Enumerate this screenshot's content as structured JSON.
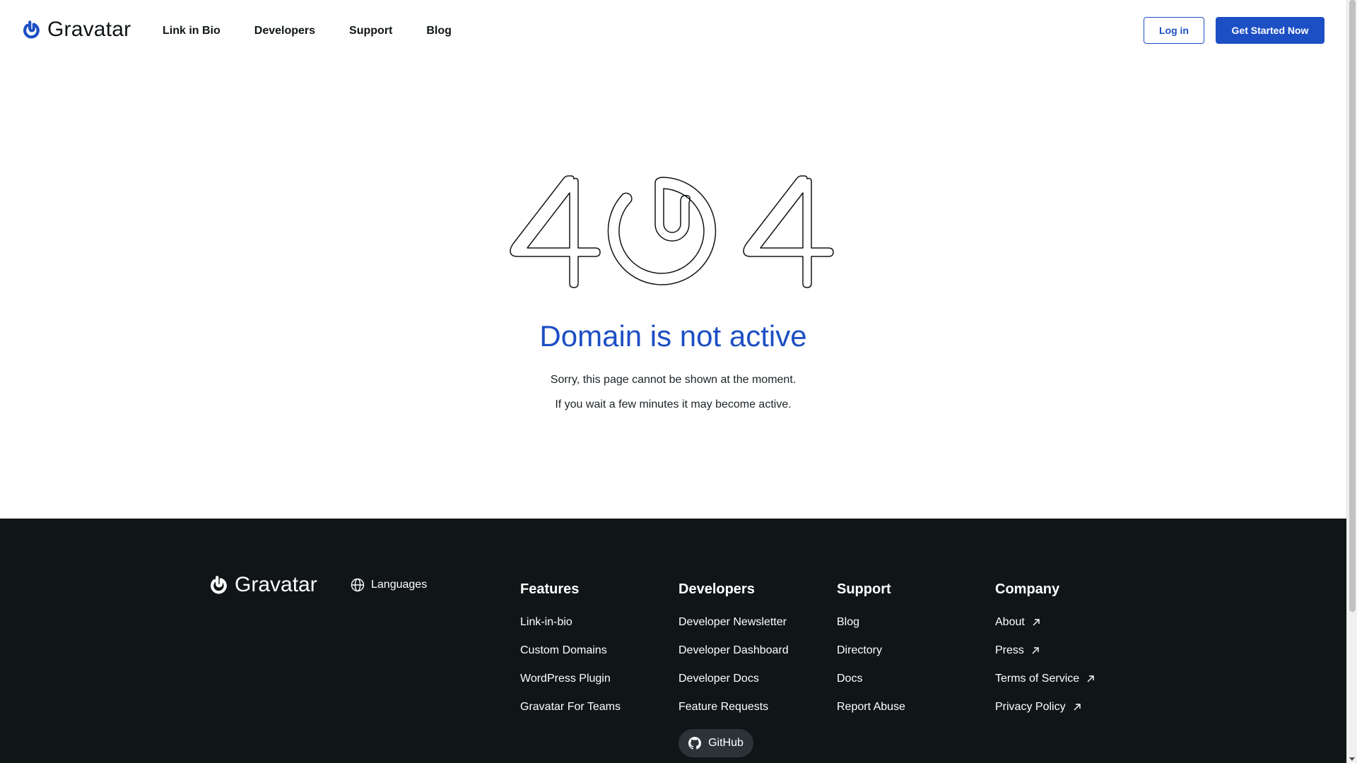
{
  "header": {
    "logo_text": "Gravatar",
    "nav": [
      {
        "label": "Link in Bio"
      },
      {
        "label": "Developers"
      },
      {
        "label": "Support"
      },
      {
        "label": "Blog"
      }
    ],
    "login_label": "Log in",
    "cta_label": "Get Started Now"
  },
  "main": {
    "error_code": "404",
    "headline": "Domain is not active",
    "message_line1": "Sorry, this page cannot be shown at the moment.",
    "message_line2": "If you wait a few minutes it may become active."
  },
  "footer": {
    "logo_text": "Gravatar",
    "languages_label": "Languages",
    "columns": [
      {
        "title": "Features",
        "items": [
          {
            "label": "Link-in-bio",
            "external": false
          },
          {
            "label": "Custom Domains",
            "external": false
          },
          {
            "label": "WordPress Plugin",
            "external": false
          },
          {
            "label": "Gravatar For Teams",
            "external": false
          }
        ]
      },
      {
        "title": "Developers",
        "items": [
          {
            "label": "Developer Newsletter",
            "external": false
          },
          {
            "label": "Developer Dashboard",
            "external": false
          },
          {
            "label": "Developer Docs",
            "external": false
          },
          {
            "label": "Feature Requests",
            "external": false
          }
        ]
      },
      {
        "title": "Support",
        "items": [
          {
            "label": "Blog",
            "external": false
          },
          {
            "label": "Directory",
            "external": false
          },
          {
            "label": "Docs",
            "external": false
          },
          {
            "label": "Report Abuse",
            "external": false
          }
        ]
      },
      {
        "title": "Company",
        "items": [
          {
            "label": "About",
            "external": true
          },
          {
            "label": "Press",
            "external": true
          },
          {
            "label": "Terms of Service",
            "external": true
          },
          {
            "label": "Privacy Policy",
            "external": true
          }
        ]
      }
    ],
    "github_label": "GitHub"
  },
  "icons": {
    "logo": "gravatar-logo-icon",
    "languages": "globe-icon",
    "external": "external-arrow-icon",
    "github": "github-icon"
  },
  "colors": {
    "brand_blue": "#1d4fc4",
    "text_dark": "#101517",
    "footer_bg": "#101517",
    "github_pill": "#2c3338"
  }
}
